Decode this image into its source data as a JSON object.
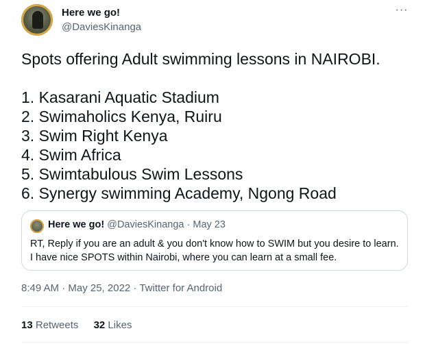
{
  "author": {
    "display_name": "Here we go!",
    "handle": "@DaviesKinanga"
  },
  "tweet": {
    "title_line": "Spots offering Adult swimming lessons in NAIROBI.",
    "list": [
      "1. Kasarani Aquatic Stadium",
      "2. Swimaholics Kenya, Ruiru",
      "3. Swim Right Kenya",
      "4. Swim Africa",
      "5. Swimtabulous Swim Lessons",
      "6. Synergy swimming Academy, Ngong Road"
    ]
  },
  "quoted": {
    "display_name": "Here we go!",
    "meta": "@DaviesKinanga · May 23",
    "text": "RT, Reply if you are an adult & you don't know how to SWIM but you desire to learn. I have nice SPOTS within Nairobi, where you can learn at a small fee."
  },
  "meta_line": "8:49 AM · May 25, 2022 · Twitter for Android",
  "stats": {
    "retweets_count": "13",
    "retweets_label": "Retweets",
    "likes_count": "32",
    "likes_label": "Likes"
  },
  "more_icon": "more-horizontal-icon"
}
